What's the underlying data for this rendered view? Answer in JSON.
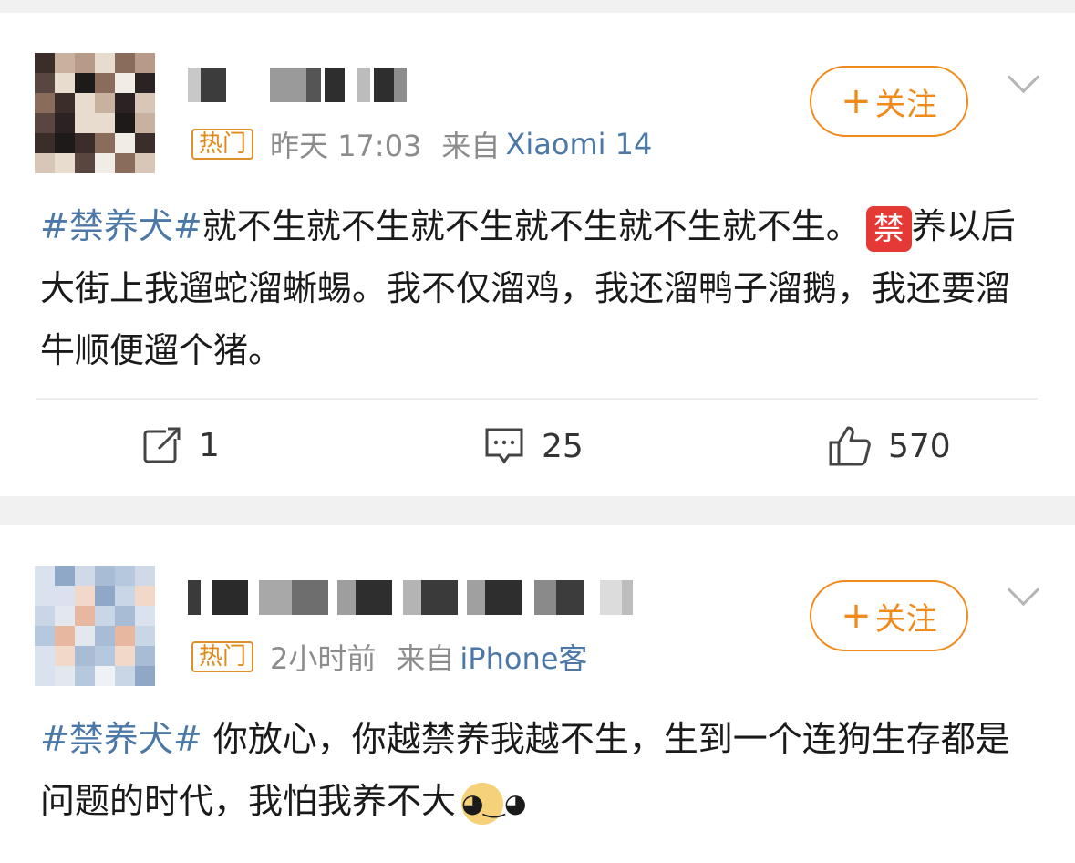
{
  "posts": [
    {
      "meta": {
        "badge": "热门",
        "time": "昨天 17:03",
        "from_label": "来自",
        "device": "Xiaomi 14"
      },
      "follow_label": "关注",
      "text": {
        "hashtag": "#禁养犬#",
        "body": "就不生就不生就不生就不生就不生就不生。",
        "emoji_label": "禁",
        "tail": "养以后大街上我遛蛇溜蜥蜴。我不仅溜鸡，我还溜鸭子溜鹅，我还要溜牛顺便遛个猪。"
      },
      "actions": {
        "repost": "1",
        "comment": "25",
        "like": "570"
      }
    },
    {
      "meta": {
        "badge": "热门",
        "time": "2小时前",
        "from_label": "来自",
        "device": "iPhone客"
      },
      "follow_label": "关注",
      "text": {
        "hashtag": "#禁养犬#",
        "body": " 你放心，你越禁养我越不生，生到一个连狗生存都是问题的时代，我怕我养不大",
        "emoji_icon": "doge-emoji"
      }
    }
  ],
  "colors": {
    "accent": "#f08a1b",
    "link": "#4c78a8",
    "badge": "#e08a1a",
    "muted": "#8c8c8c"
  }
}
